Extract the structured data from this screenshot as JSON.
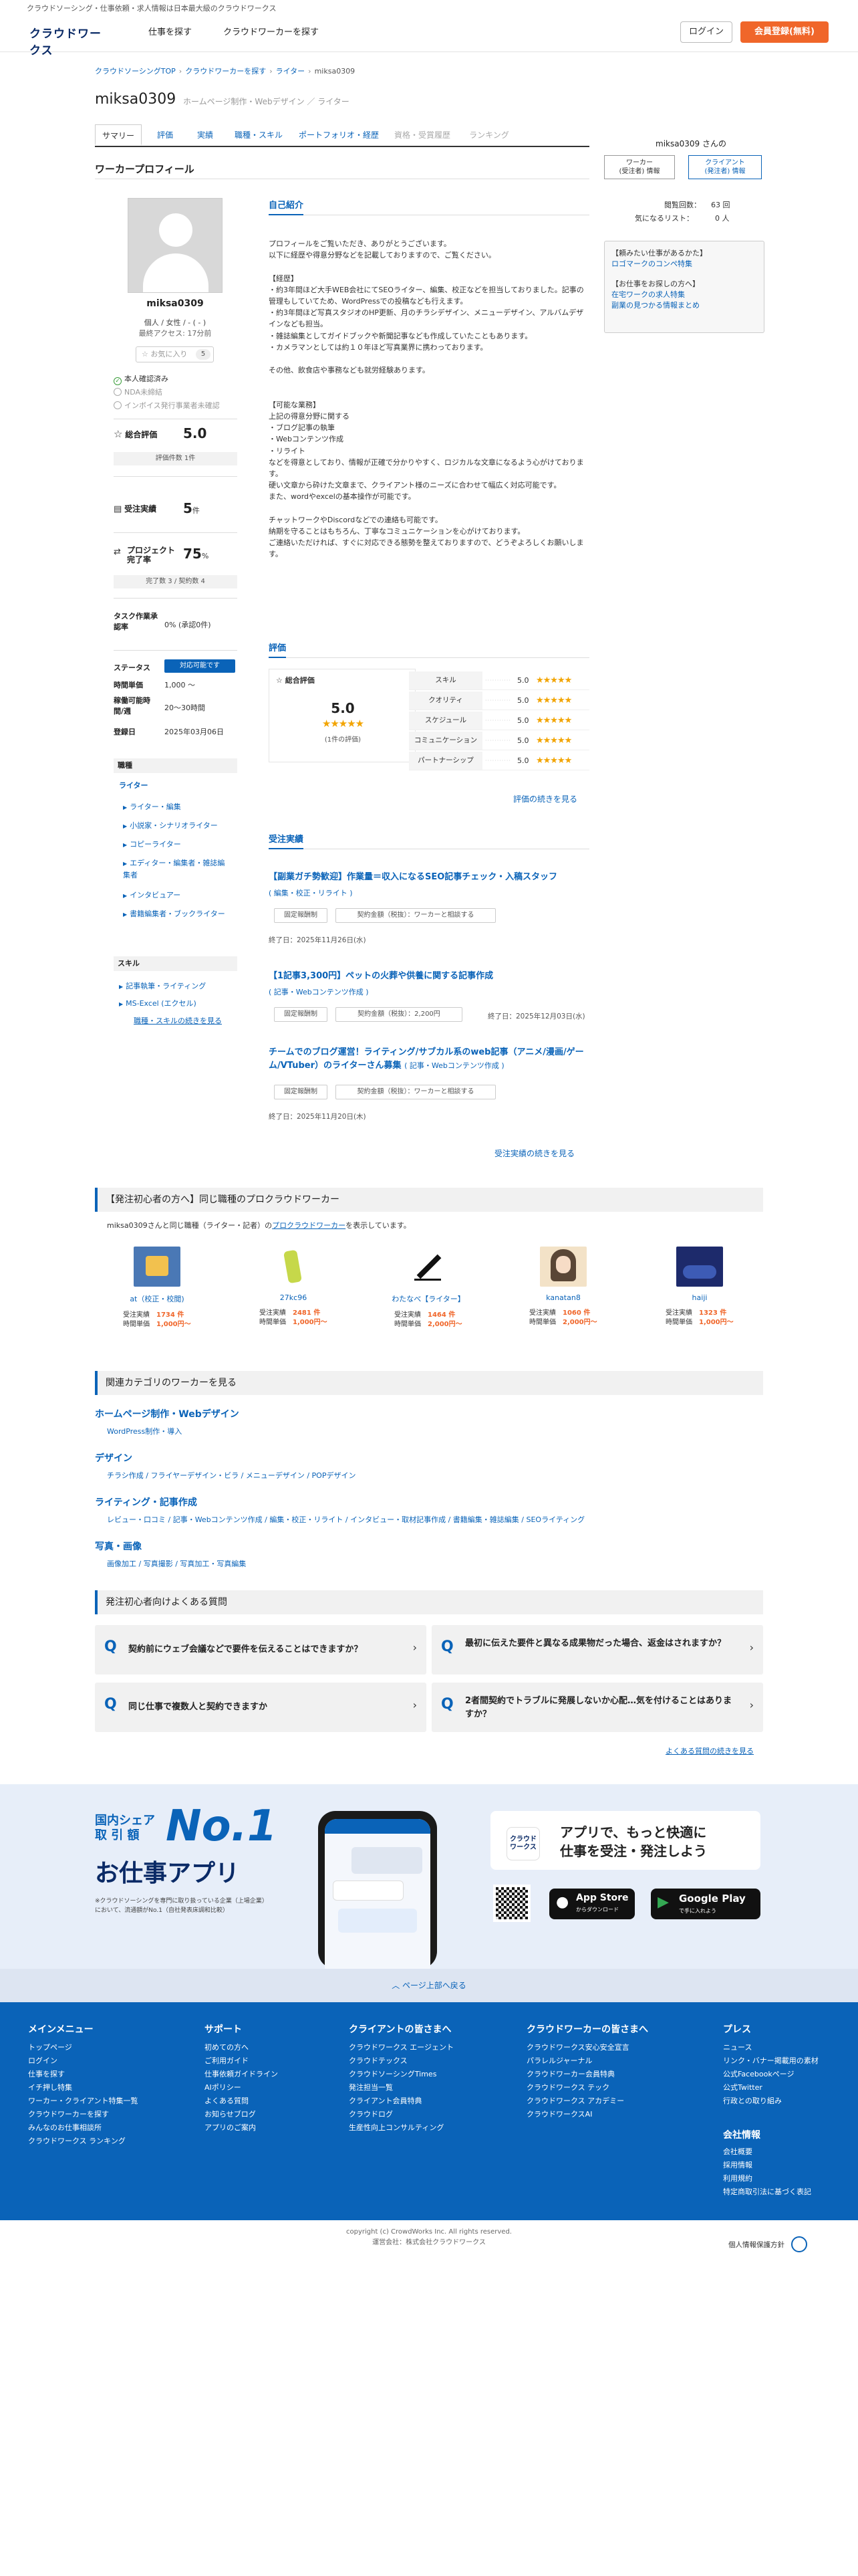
{
  "tagline": "クラウドソーシング・仕事依頼・求人情報は日本最大級のクラウドワークス",
  "header": {
    "logo_text": "クラウドワークス",
    "nav": [
      "仕事を探す",
      "クラウドワーカーを探す"
    ],
    "login": "ログイン",
    "signup": "会員登録(無料)"
  },
  "breadcrumb": [
    "クラウドソーシングTOP",
    "クラウドワーカーを探す",
    "ライター",
    "miksa0309"
  ],
  "profile": {
    "username": "miksa0309",
    "categories": "ホームページ制作・Webデザイン ／ ライター",
    "tabs": [
      "サマリー",
      "評価",
      "実績",
      "職種・スキル",
      "ポートフォリオ・経歴",
      "資格・受賞履歴",
      "ランキング"
    ],
    "section_title": "ワーカープロフィール",
    "display_name": "miksa0309",
    "info": "個人 / 女性 / - ( - )",
    "last_access": "最終アクセス: 17分前",
    "favorite_label": "☆ お気に入り",
    "favorite_count": "5",
    "verifications": [
      "本人確認済み",
      "NDA未締結",
      "インボイス発行事業者未確認"
    ],
    "rating_label": "総合評価",
    "rating_value": "5.0",
    "rating_count": "評価件数 1件",
    "orders_label": "受注実績",
    "orders_value": "5",
    "orders_unit": "件",
    "completion_label": "プロジェクト完了率",
    "completion_value": "75",
    "completion_unit": "%",
    "completion_sub": "完了数 3 / 契約数 4",
    "task_label": "タスク作業承認率",
    "task_value": "0% (承認0件)",
    "status_label": "ステータス",
    "status_btn": "対応可能です",
    "hourly_label": "時間単価",
    "hourly_value": "1,000 〜",
    "hours_label": "稼働可能時間/週",
    "hours_value": "20〜30時間",
    "reg_label": "登録日",
    "reg_value": "2025年03月06日",
    "jobs_title": "職種",
    "jobs_group": "ライター",
    "jobs_items": [
      "ライター・編集",
      "小説家・シナリオライター",
      "コピーライター",
      "エディター・編集者・雑誌編集者",
      "インタビュアー",
      "書籍編集者・ブックライター"
    ],
    "skills_title": "スキル",
    "skills_items": [
      "記事執筆・ライティング",
      "MS-Excel (エクセル)"
    ],
    "skills_more": "職種・スキルの続きを見る"
  },
  "intro": {
    "title": "自己紹介",
    "text": "プロフィールをご覧いただき、ありがとうございます。\n以下に経歴や得意分野などを記載しておりますので、ご覧ください。\n\n【経歴】\n・約3年間ほど大手WEB会社にてSEOライター、編集、校正などを担当しておりました。記事の管理もしていてため、WordPressでの投稿なども行えます。\n・約3年間ほど写真スタジオのHP更新、月のチラシデザイン、メニューデザイン、アルバムデザインなども担当。\n・雑誌編集としてガイドブックや新聞記事なども作成していたこともあります。\n・カメラマンとしては約１０年ほど写真業界に携わっております。\n\nその他、飲食店や事務なども就労経験あります。\n\n\n【可能な業務】\n上記の得意分野に関する\n・ブログ記事の執筆\n・Webコンテンツ作成\n・リライト\nなどを得意としており、情報が正確で分かりやすく、ロジカルな文章になるよう心がけております。\n硬い文章から砕けた文章まで、クライアント様のニーズに合わせて幅広く対応可能です。\nまた、wordやexcelの基本操作が可能です。\n\nチャットワークやDiscordなどでの連絡も可能です。\n納期を守ることはもちろん、丁寧なコミュニケーションを心がけております。\nご連絡いただければ、すぐに対応できる態勢を整えておりますので、どうぞよろしくお願いします。"
  },
  "evaluation": {
    "title": "評価",
    "total_label": "総合評価",
    "score": "5.0",
    "count": "(1件の評価)",
    "rows": [
      {
        "label": "スキル",
        "score": "5.0"
      },
      {
        "label": "クオリティ",
        "score": "5.0"
      },
      {
        "label": "スケジュール",
        "score": "5.0"
      },
      {
        "label": "コミュニケーション",
        "score": "5.0"
      },
      {
        "label": "パートナーシップ",
        "score": "5.0"
      }
    ],
    "more": "評価の続きを見る"
  },
  "orders": {
    "title": "受注実績",
    "items": [
      {
        "title": "【副業ガチ勢歓迎】作業量＝収入になるSEO記事チェック・入稿スタッフ",
        "category": "( 編集・校正・リライト )",
        "type": "固定報酬制",
        "amount": "契約金額（税抜）：ワーカーと相談する",
        "end": "終了日：2025年11月26日(水)"
      },
      {
        "title": "【1記事3,300円】ペットの火葬や供養に関する記事作成",
        "category": "( 記事・Webコンテンツ作成 )",
        "type": "固定報酬制",
        "amount": "契約金額（税抜）：2,200円",
        "end": "終了日：2025年12月03日(水)"
      },
      {
        "title": "チームでのブログ運営！ライティング/サブカル系のweb記事（アニメ/漫画/ゲーム/VTuber）のライターさん募集",
        "category": "( 記事・Webコンテンツ作成 )",
        "type": "固定報酬制",
        "amount": "契約金額（税抜）：ワーカーと相談する",
        "end": "終了日：2025年11月20日(木)"
      }
    ],
    "more": "受注実績の続きを見る"
  },
  "right": {
    "name": "miksa0309 さんの",
    "tab1": "ワーカー\n(受注者) 情報",
    "tab2": "クライアント\n(発注者) 情報",
    "views_label": "閲覧回数：",
    "views_value": "63 回",
    "fav_label": "気になるリスト：",
    "fav_value": "0 人",
    "promo_h1": "【頼みたい仕事があるかた】",
    "promo_l1": "ロゴマークのコンペ特集",
    "promo_h2": "【お仕事をお探しの方へ】",
    "promo_l2": "在宅ワークの求人特集",
    "promo_l3": "副業の見つかる情報まとめ"
  },
  "similar": {
    "title": "【発注初心者の方へ】同じ職種のプロクラウドワーカー",
    "desc": "miksa0309さんと同じ職種（ライター・記者）の",
    "desc_link": "プロクラウドワーカー",
    "desc_tail": "を表示しています。",
    "workers": [
      {
        "name": "at（校正・校閲)",
        "orders": "1734 件",
        "rate": "1,000円〜"
      },
      {
        "name": "27kc96",
        "orders": "2481 件",
        "rate": "1,000円〜"
      },
      {
        "name": "わたなべ【ライター】",
        "orders": "1464 件",
        "rate": "2,000円〜"
      },
      {
        "name": "kanatan8",
        "orders": "1060 件",
        "rate": "2,000円〜"
      },
      {
        "name": "haiji",
        "orders": "1323 件",
        "rate": "1,000円〜"
      }
    ],
    "orders_label": "受注実績",
    "rate_label": "時間単価"
  },
  "related": {
    "title": "関連カテゴリのワーカーを見る",
    "groups": [
      {
        "head": "ホームページ制作・Webデザイン",
        "links": "WordPress制作・導入"
      },
      {
        "head": "デザイン",
        "links": "チラシ作成 / フライヤーデザイン・ビラ / メニューデザイン / POPデザイン"
      },
      {
        "head": "ライティング・記事作成",
        "links": "レビュー・口コミ / 記事・Webコンテンツ作成 / 編集・校正・リライト / インタビュー・取材記事作成 / 書籍編集・雑誌編集 / SEOライティング"
      },
      {
        "head": "写真・画像",
        "links": "画像加工 / 写真撮影 / 写真加工・写真編集"
      }
    ]
  },
  "faq": {
    "title": "発注初心者向けよくある質問",
    "items": [
      "契約前にウェブ会議などで要件を伝えることはできますか？",
      "最初に伝えた要件と異なる成果物だった場合、返金はされますか？",
      "同じ仕事で複数人と契約できますか",
      "2者間契約でトラブルに発展しないか心配…気を付けることはありますか？"
    ],
    "more": "よくある質問の続きを見る"
  },
  "app": {
    "share": "国内シェア",
    "share2": "取 引 額",
    "no1": "No.1",
    "headline": "お仕事アプリ",
    "note": "※クラウドソーシングを専門に取り扱っている企業（上場企業）において、流通額がNo.1（自社発表床調和比較）",
    "bubble": "アプリで、もっと快適に\n仕事を受注・発注しよう",
    "appstore": "App Store",
    "appstore_sub": "からダウンロード",
    "gplay": "Google Play",
    "gplay_sub": "で手に入れよう"
  },
  "backtop": "︿ ページ上部へ戻る",
  "footer": {
    "cols": [
      {
        "head": "メインメニュー",
        "links": [
          "トップページ",
          "ログイン",
          "仕事を探す",
          "イチ押し特集",
          "ワーカー・クライアント特集一覧",
          "クラウドワーカーを探す",
          "みんなのお仕事相談所",
          "クラウドワークス ランキング"
        ]
      },
      {
        "head": "サポート",
        "links": [
          "初めての方へ",
          "ご利用ガイド",
          "仕事依頼ガイドライン",
          "AIポリシー",
          "よくある質問",
          "お知らせブログ",
          "アプリのご案内"
        ]
      },
      {
        "head": "クライアントの皆さまへ",
        "links": [
          "クラウドワークス エージェント",
          "クラウドテックス",
          "クラウドソーシングTimes",
          "発注担当一覧",
          "クライアント会員特典",
          "クラウドログ",
          "生産性向上コンサルティング"
        ]
      },
      {
        "head": "クラウドワーカーの皆さまへ",
        "links": [
          "クラウドワークス安心安全宣言",
          "パラレルジャーナル",
          "クラウドワーカー会員特典",
          "クラウドワークス テック",
          "クラウドワークス アカデミー",
          "クラウドワークスAI"
        ]
      },
      {
        "head": "プレス",
        "links": [
          "ニュース",
          "リンク・バナー掲載用の素材",
          "公式Facebookページ",
          "公式Twitter",
          "行政との取り組み"
        ]
      }
    ],
    "company_head": "会社情報",
    "company_links": [
      "会社概要",
      "採用情報",
      "利用規約",
      "特定商取引法に基づく表記"
    ]
  },
  "copyright": "copyright (c) CrowdWorks Inc. All rights reserved.",
  "operator": "運営会社：株式会社クラウドワークス",
  "privacy": "個人情報保護方針"
}
